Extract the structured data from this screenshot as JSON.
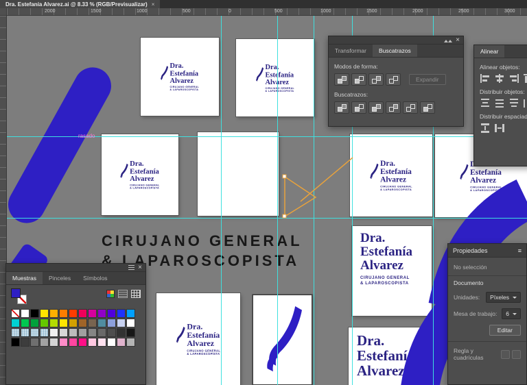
{
  "window": {
    "tab_title": "Dra. Estefanía Alvarez.ai @ 8.33 % (RGB/Previsualizar)",
    "tab_close": "×"
  },
  "ruler": {
    "labels": [
      "2000",
      "1500",
      "1000",
      "500",
      "0",
      "500",
      "1000",
      "1500",
      "2000",
      "2500",
      "3000"
    ]
  },
  "logo": {
    "dra": "Dra.",
    "name1": "Estefanía",
    "name2": "Alvarez",
    "sub1": "CIRUJANO GENERAL",
    "sub2": "& LAPAROSCOPISTA"
  },
  "canvas_text": {
    "heading1": "CIRUJANO GENERAL",
    "heading2": "& LAPAROSCOPISTA",
    "pink_label": "rasado"
  },
  "pathfinder_panel": {
    "tabs": [
      "Transformar",
      "Buscatrazos"
    ],
    "shape_modes_label": "Modos de forma:",
    "expand_button": "Expandir",
    "pathfinders_label": "Buscatrazos:"
  },
  "align_panel": {
    "title": "Alinear",
    "align_objects_label": "Alinear objetos:",
    "distribute_objects_label": "Distribuir objetos:",
    "distribute_spacing_label": "Distribuir espaciado"
  },
  "swatches_panel": {
    "tabs": [
      "Muestras",
      "Pinceles",
      "Símbolos"
    ],
    "swatch_rows": [
      [
        "none",
        "#ffffff",
        "#000000",
        "#ffe500",
        "#ffb000",
        "#ff7d00",
        "#ff3c00",
        "#f0005a",
        "#d6009e",
        "#9000c8",
        "#5000dc",
        "#1e32ff",
        "#00a0ff"
      ],
      [
        "#00d2d2",
        "#00c850",
        "#00a03c",
        "#64c800",
        "#b4dc00",
        "#ffe600",
        "#d2a000",
        "#a06428",
        "#786450",
        "#508ca0",
        "#8ca0dc",
        "#c8d2f0",
        "#ffffff"
      ],
      [
        "pattern",
        "pattern",
        "pattern",
        "pattern",
        "#f0f0f0",
        "#d7d7d7",
        "#bcbcbc",
        "#a0a0a0",
        "#858585",
        "#696969",
        "#4e4e4e",
        "#323232",
        "#171717"
      ],
      [
        "#000000",
        "#3d3d3d",
        "#6f6f6f",
        "#a2a2a2",
        "#d4d4d4",
        "#ff8cc8",
        "#ff46a0",
        "#ff0f87",
        "#ffc8e1",
        "#ffe1ee",
        "#ffffff",
        "#e0b4cd",
        "#b4b4b4"
      ]
    ]
  },
  "properties_panel": {
    "title": "Propiedades",
    "no_selection": "No selección",
    "document_label": "Documento",
    "units_label": "Unidades:",
    "units_value": "Píxeles",
    "artboard_label": "Mesa de trabajo:",
    "artboard_value": "6",
    "edit_button": "Editar",
    "rulers_label": "Regla y cuadrículas"
  },
  "colors": {
    "logo_navy": "#2b2383",
    "artwork_blue": "#2e1fc4",
    "guide_cyan": "#3ee0df",
    "selection_orange": "#e8a23c",
    "pink": "#ff7ade"
  }
}
